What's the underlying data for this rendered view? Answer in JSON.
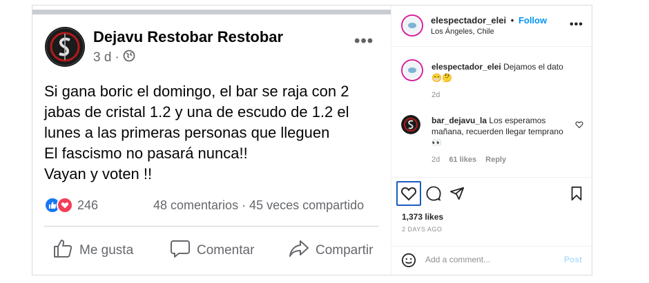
{
  "facebook_post": {
    "page_name": "Dejavu Restobar Restobar",
    "time": "3 d",
    "separator": "·",
    "body_lines": [
      "Si gana boric el domingo, el bar se raja con 2",
      "jabas de cristal 1.2 y una de escudo de 1.2 el",
      "lunes a las primeras personas que lleguen",
      "El fascismo no pasará nunca!!",
      "Vayan y voten !!"
    ],
    "reactions_count": "246",
    "stats": "48 comentarios · 45 veces compartido",
    "actions": {
      "like": "Me gusta",
      "comment": "Comentar",
      "share": "Compartir"
    }
  },
  "instagram": {
    "header": {
      "username": "elespectador_elei",
      "dot": "•",
      "follow_label": "Follow",
      "location": "Los Ángeles, Chile",
      "more": "•••"
    },
    "comments": [
      {
        "username": "elespectador_elei",
        "text": "Dejamos el dato 😁🤔",
        "time": "2d"
      },
      {
        "username": "bar_dejavu_la",
        "text": "Los esperamos mañana, recuerden llegar temprano 👀",
        "time": "2d",
        "likes": "61 likes",
        "reply": "Reply"
      }
    ],
    "likes": "1,373 likes",
    "posted": "2 DAYS AGO",
    "add_comment_placeholder": "Add a comment...",
    "post_label": "Post"
  },
  "colors": {
    "fb_blue": "#1877f2",
    "love_red": "#f33e58",
    "ig_blue": "#0095f6",
    "focus_ring": "#1a5bc4"
  }
}
